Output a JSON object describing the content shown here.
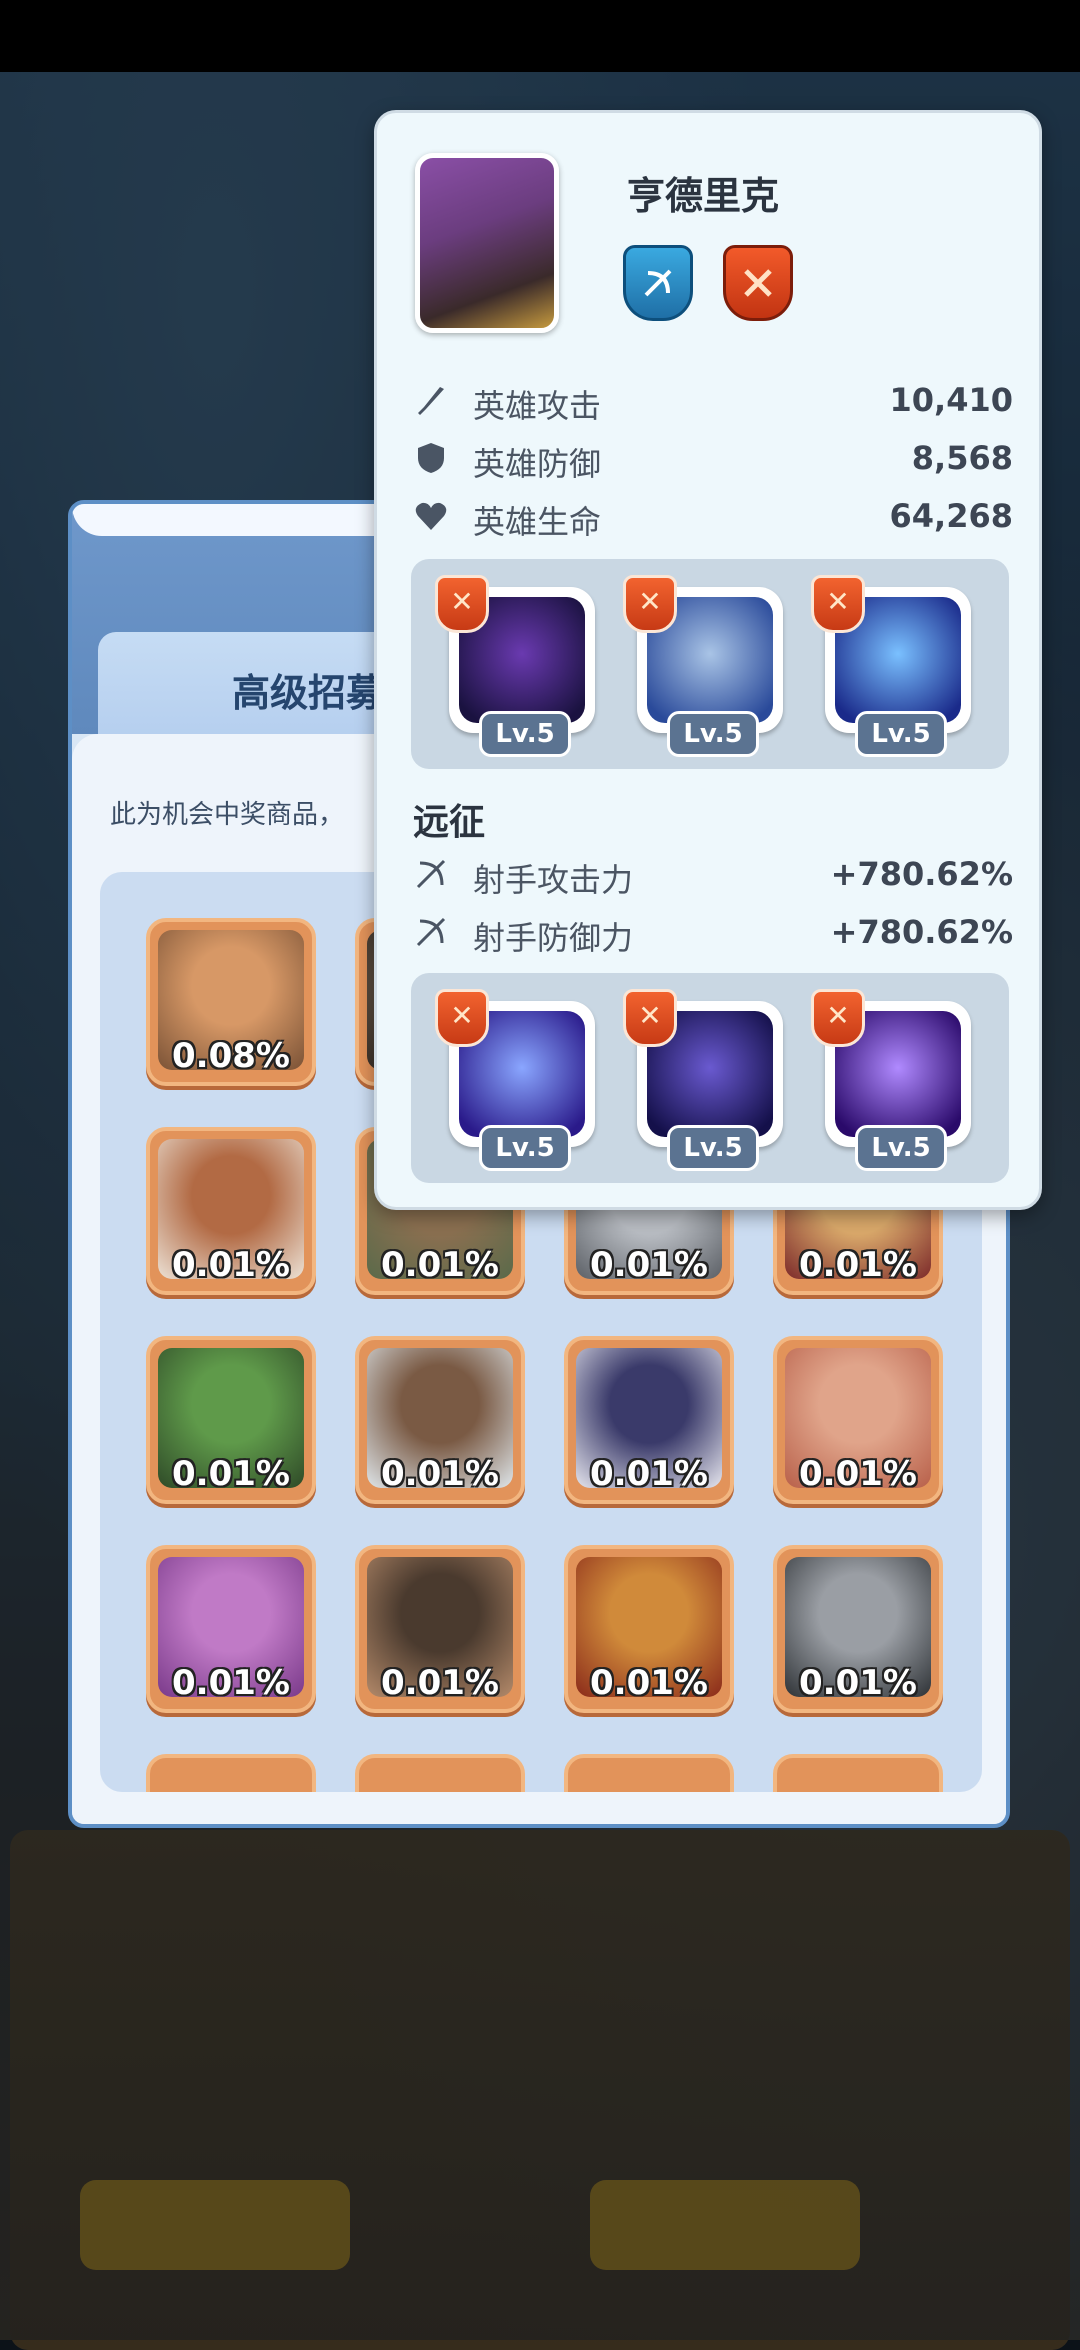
{
  "recruit": {
    "tab_title": "高级招募",
    "notice": "此为机会中奖商品，",
    "heroes": [
      {
        "rate": "0.08%",
        "colors": [
          "#d79866",
          "#7a5236"
        ]
      },
      {
        "rate": "",
        "colors": [
          "#6a5a4a",
          "#3a3028"
        ]
      },
      {
        "rate": "",
        "colors": [
          "#c0c8d0",
          "#6a7078"
        ]
      },
      {
        "rate": "",
        "colors": [
          "#c99a5c",
          "#6a4a2a"
        ]
      },
      {
        "rate": "0.01%",
        "colors": [
          "#b26a44",
          "#ece2d6"
        ]
      },
      {
        "rate": "0.01%",
        "colors": [
          "#8a6f50",
          "#5a6a4a"
        ]
      },
      {
        "rate": "0.01%",
        "colors": [
          "#b8bcc2",
          "#5c6066"
        ]
      },
      {
        "rate": "0.01%",
        "colors": [
          "#d9a86a",
          "#7c2a2a"
        ]
      },
      {
        "rate": "0.01%",
        "colors": [
          "#5f9a4a",
          "#2f4a28"
        ]
      },
      {
        "rate": "0.01%",
        "colors": [
          "#7a5a44",
          "#dfe6ea"
        ]
      },
      {
        "rate": "0.01%",
        "colors": [
          "#3a3a6a",
          "#e6e6ee"
        ]
      },
      {
        "rate": "0.01%",
        "colors": [
          "#e0a48a",
          "#b8604a"
        ]
      },
      {
        "rate": "0.01%",
        "colors": [
          "#c07ac6",
          "#7a3a8a"
        ]
      },
      {
        "rate": "0.01%",
        "colors": [
          "#4a3a2e",
          "#b48a6a"
        ]
      },
      {
        "rate": "0.01%",
        "colors": [
          "#d08a3a",
          "#8a2a1a"
        ]
      },
      {
        "rate": "0.01%",
        "colors": [
          "#9a9ea4",
          "#2e3236"
        ]
      }
    ]
  },
  "hero_card": {
    "name": "亨德里克",
    "badges": [
      "archer-class-badge",
      "red-rarity-badge"
    ],
    "stats": [
      {
        "label": "英雄攻击",
        "value": "10,410",
        "icon": "sword-icon"
      },
      {
        "label": "英雄防御",
        "value": "8,568",
        "icon": "shield-icon"
      },
      {
        "label": "英雄生命",
        "value": "64,268",
        "icon": "heart-icon"
      }
    ],
    "skills": [
      {
        "level": "Lv.5",
        "colors": [
          "#6a3ab0",
          "#1a1240"
        ]
      },
      {
        "level": "Lv.5",
        "colors": [
          "#a9c4e6",
          "#2a4a9a"
        ]
      },
      {
        "level": "Lv.5",
        "colors": [
          "#7ac0ff",
          "#1a2a8a"
        ]
      }
    ],
    "expedition_title": "远征",
    "expedition_stats": [
      {
        "label": "射手攻击力",
        "value": "+780.62%",
        "icon": "bow-icon"
      },
      {
        "label": "射手防御力",
        "value": "+780.62%",
        "icon": "bow-icon"
      }
    ],
    "expedition_skills": [
      {
        "level": "Lv.5",
        "colors": [
          "#8aa6ff",
          "#2a1a8a"
        ]
      },
      {
        "level": "Lv.5",
        "colors": [
          "#6a5ad0",
          "#14104a"
        ]
      },
      {
        "level": "Lv.5",
        "colors": [
          "#b08aff",
          "#2a0a6a"
        ]
      }
    ]
  }
}
